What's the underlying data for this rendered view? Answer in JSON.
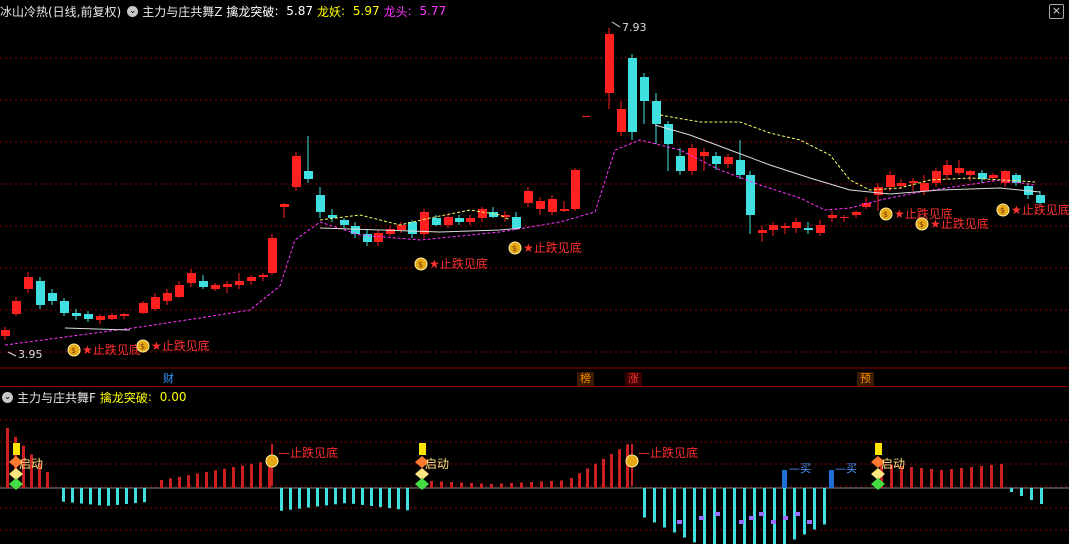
{
  "top_panel": {
    "title": "冰山冷热(日线,前复权)",
    "indicator_name": "主力与庄共舞Z",
    "values": [
      {
        "label": "擒龙突破",
        "value": "5.87",
        "color": "#ffffff"
      },
      {
        "label": "龙妖",
        "value": "5.97",
        "color": "#ffff00"
      },
      {
        "label": "龙头",
        "value": "5.77",
        "color": "#ff00ff"
      }
    ],
    "high_label": "7.93",
    "low_label": "3.95",
    "signal_text": "★止跌见底"
  },
  "bottom_panel": {
    "indicator_name": "主力与庄共舞F",
    "values": [
      {
        "label": "擒龙突破",
        "value": "0.00",
        "color": "#ffff00"
      }
    ],
    "signal_text": "止跌见底",
    "start_text": "启动",
    "buy_text": "买"
  },
  "event_markers": [
    {
      "text": "财",
      "color": "#3399ff"
    },
    {
      "text": "榜",
      "color": "#ff8c00"
    },
    {
      "text": "涨",
      "color": "#ff3333"
    },
    {
      "text": "预",
      "color": "#ff8c00"
    }
  ],
  "colors": {
    "up": "#ff2020",
    "down": "#40e0e0",
    "ma": "#ffffff",
    "dash_yellow": "#ffff66",
    "dash_magenta": "#ff33ff",
    "grid": "#8b0000"
  }
}
